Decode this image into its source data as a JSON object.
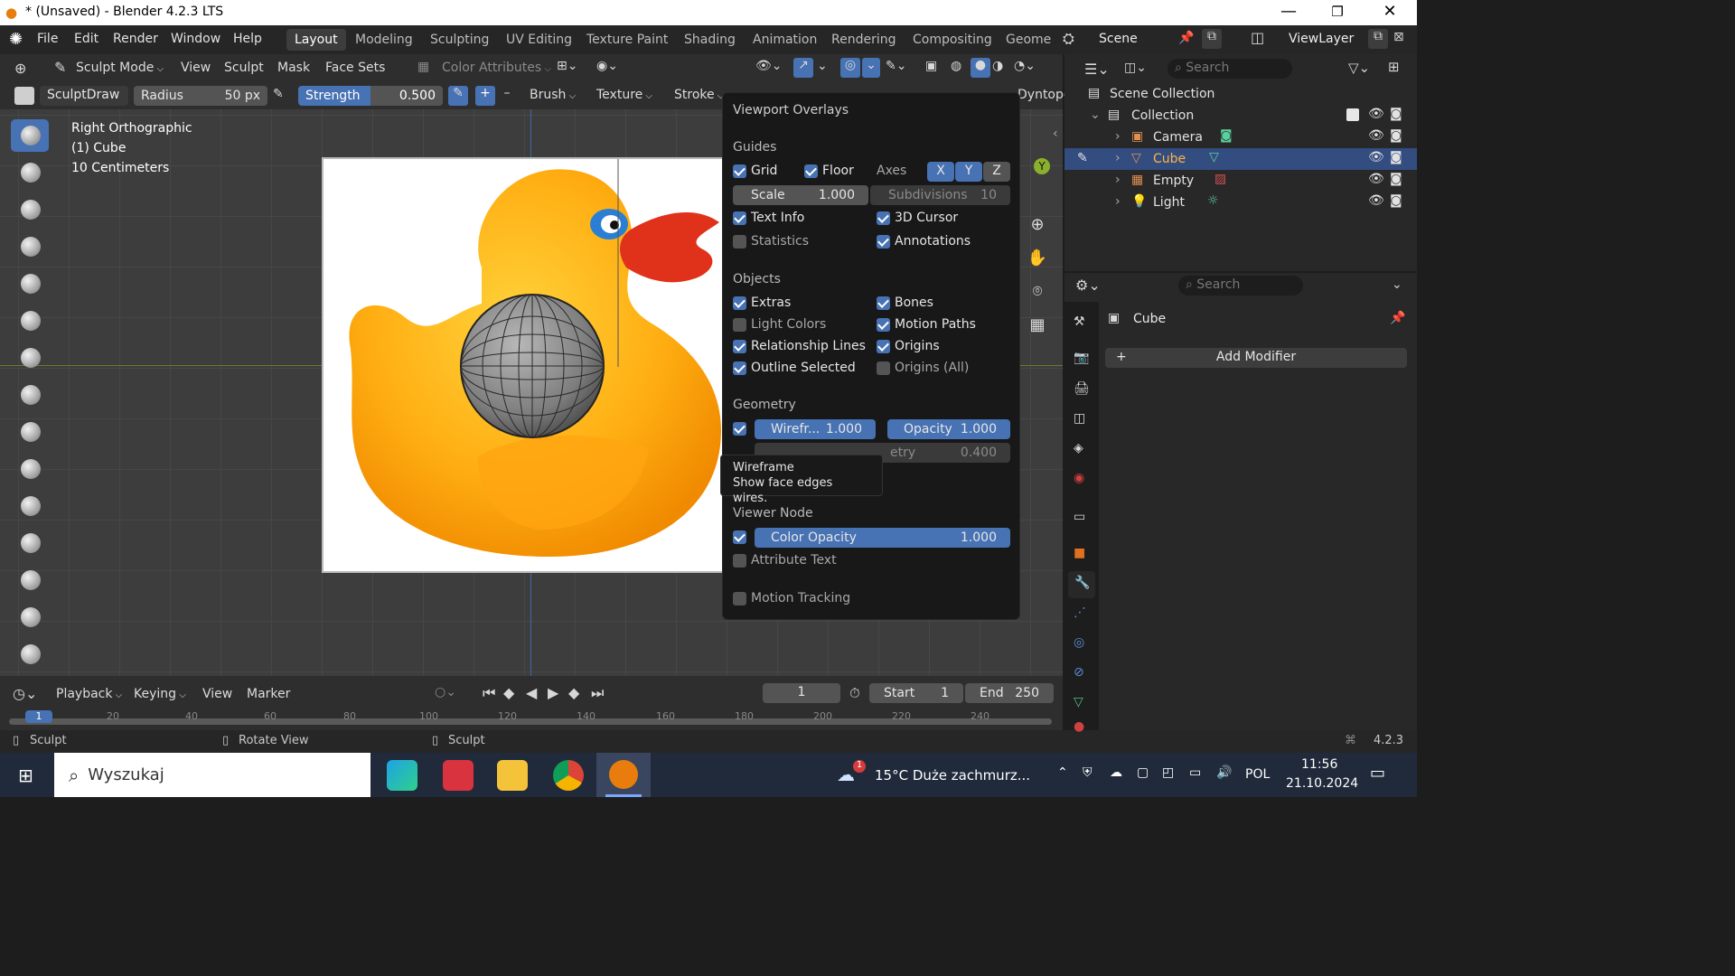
{
  "window": {
    "title": "* (Unsaved) - Blender 4.2.3 LTS"
  },
  "menubar": {
    "items": [
      "File",
      "Edit",
      "Render",
      "Window",
      "Help"
    ],
    "workspaces": [
      "Layout",
      "Modeling",
      "Sculpting",
      "UV Editing",
      "Texture Paint",
      "Shading",
      "Animation",
      "Rendering",
      "Compositing",
      "Geome"
    ],
    "active_workspace": "Layout",
    "scene": "Scene",
    "view_layer": "ViewLayer"
  },
  "header1": {
    "mode": "Sculpt Mode",
    "menus": [
      "View",
      "Sculpt",
      "Mask",
      "Face Sets"
    ],
    "color_attributes": "Color Attributes"
  },
  "header2": {
    "brush_name": "SculptDraw",
    "radius_label": "Radius",
    "radius_value": "50 px",
    "strength_label": "Strength",
    "strength_value": "0.500",
    "plus": "+",
    "minus": "–",
    "brush": "Brush",
    "texture": "Texture",
    "stroke": "Stroke",
    "dyntopo": "Dyntopo"
  },
  "viewport": {
    "view_name": "Right Orthographic",
    "object": "(1) Cube",
    "scale": "10 Centimeters",
    "axis_y": "Y"
  },
  "overlays": {
    "title": "Viewport Overlays",
    "guides": {
      "header": "Guides",
      "grid": "Grid",
      "floor": "Floor",
      "axes": "Axes",
      "x": "X",
      "y": "Y",
      "z": "Z",
      "scale_label": "Scale",
      "scale_value": "1.000",
      "subdiv_label": "Subdivisions",
      "subdiv_value": "10",
      "text_info": "Text Info",
      "cursor": "3D Cursor",
      "statistics": "Statistics",
      "annotations": "Annotations"
    },
    "objects": {
      "header": "Objects",
      "extras": "Extras",
      "bones": "Bones",
      "light_colors": "Light Colors",
      "motion_paths": "Motion Paths",
      "relationship_lines": "Relationship Lines",
      "origins": "Origins",
      "outline_selected": "Outline Selected",
      "origins_all": "Origins (All)"
    },
    "geometry": {
      "header": "Geometry",
      "wire_label": "Wirefr...",
      "wire_value": "1.000",
      "opacity_label": "Opacity",
      "opacity_value": "1.000",
      "fade_value": "0.400",
      "fade_label_partial": "etry"
    },
    "viewer_node": {
      "header": "Viewer Node",
      "color_opacity_label": "Color Opacity",
      "color_opacity_value": "1.000",
      "attribute_text": "Attribute Text"
    },
    "motion_tracking": "Motion Tracking"
  },
  "tooltip": {
    "title": "Wireframe",
    "text": "Show face edges wires."
  },
  "timeline": {
    "menus": [
      "Playback",
      "Keying",
      "View",
      "Marker"
    ],
    "current_frame": "1",
    "start_label": "Start",
    "start_value": "1",
    "end_label": "End",
    "end_value": "250",
    "ruler": [
      "1",
      "20",
      "40",
      "60",
      "80",
      "100",
      "120",
      "140",
      "160",
      "180",
      "200",
      "220",
      "240"
    ]
  },
  "statusbar": {
    "left": "Sculpt",
    "mid": "Rotate View",
    "right": "Sculpt",
    "version": "4.2.3"
  },
  "outliner": {
    "search_placeholder": "Search",
    "scene_collection": "Scene Collection",
    "collection": "Collection",
    "items": [
      "Camera",
      "Cube",
      "Empty",
      "Light"
    ]
  },
  "properties": {
    "search_placeholder": "Search",
    "object": "Cube",
    "add_modifier": "Add Modifier"
  },
  "taskbar": {
    "search": "Wyszukaj",
    "weather": "15°C  Duże zachmurz...",
    "weather_badge": "1",
    "lang": "POL",
    "time": "11:56",
    "date": "21.10.2024"
  },
  "colors": {
    "accent": "#4772b3",
    "panel": "#2e2e2e",
    "viewport": "#3d3d3d",
    "duck": "#ffb010",
    "selected_row": "#334d80"
  }
}
